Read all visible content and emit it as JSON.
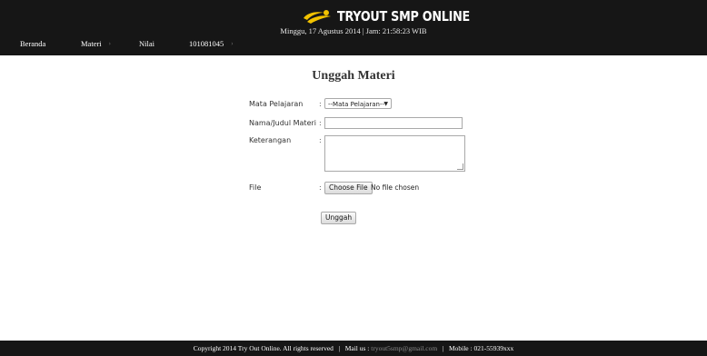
{
  "header": {
    "logo_text": "TRYOUT SMP ONLINE",
    "datetime": "Minggu, 17 Agustus 2014 | Jam: 21:58:23 WIB",
    "accent_color": "#f2c200"
  },
  "nav": {
    "items": [
      {
        "label": "Beranda",
        "has_dropdown": false
      },
      {
        "label": "Materi",
        "has_dropdown": true
      },
      {
        "label": "Nilai",
        "has_dropdown": false
      },
      {
        "label": "101081045",
        "has_dropdown": true
      }
    ]
  },
  "main": {
    "title": "Unggah Materi"
  },
  "form": {
    "subject_label": "Mata Pelajaran",
    "subject_selected": "--Mata Pelajaran--",
    "name_label": "Nama/Judul Materi",
    "name_value": "",
    "description_label": "Keterangan",
    "description_value": "",
    "file_label": "File",
    "file_button": "Choose File",
    "file_status": "No file chosen",
    "submit_label": "Unggah",
    "colon": ":"
  },
  "footer": {
    "copyright": "Copyright 2014 Try Out Online. All rights reserved",
    "mail_label": "Mail us :",
    "mail": "tryout5smp@gmail.com",
    "mobile": "Mobile : 021-55939xxx",
    "sep": "|"
  }
}
